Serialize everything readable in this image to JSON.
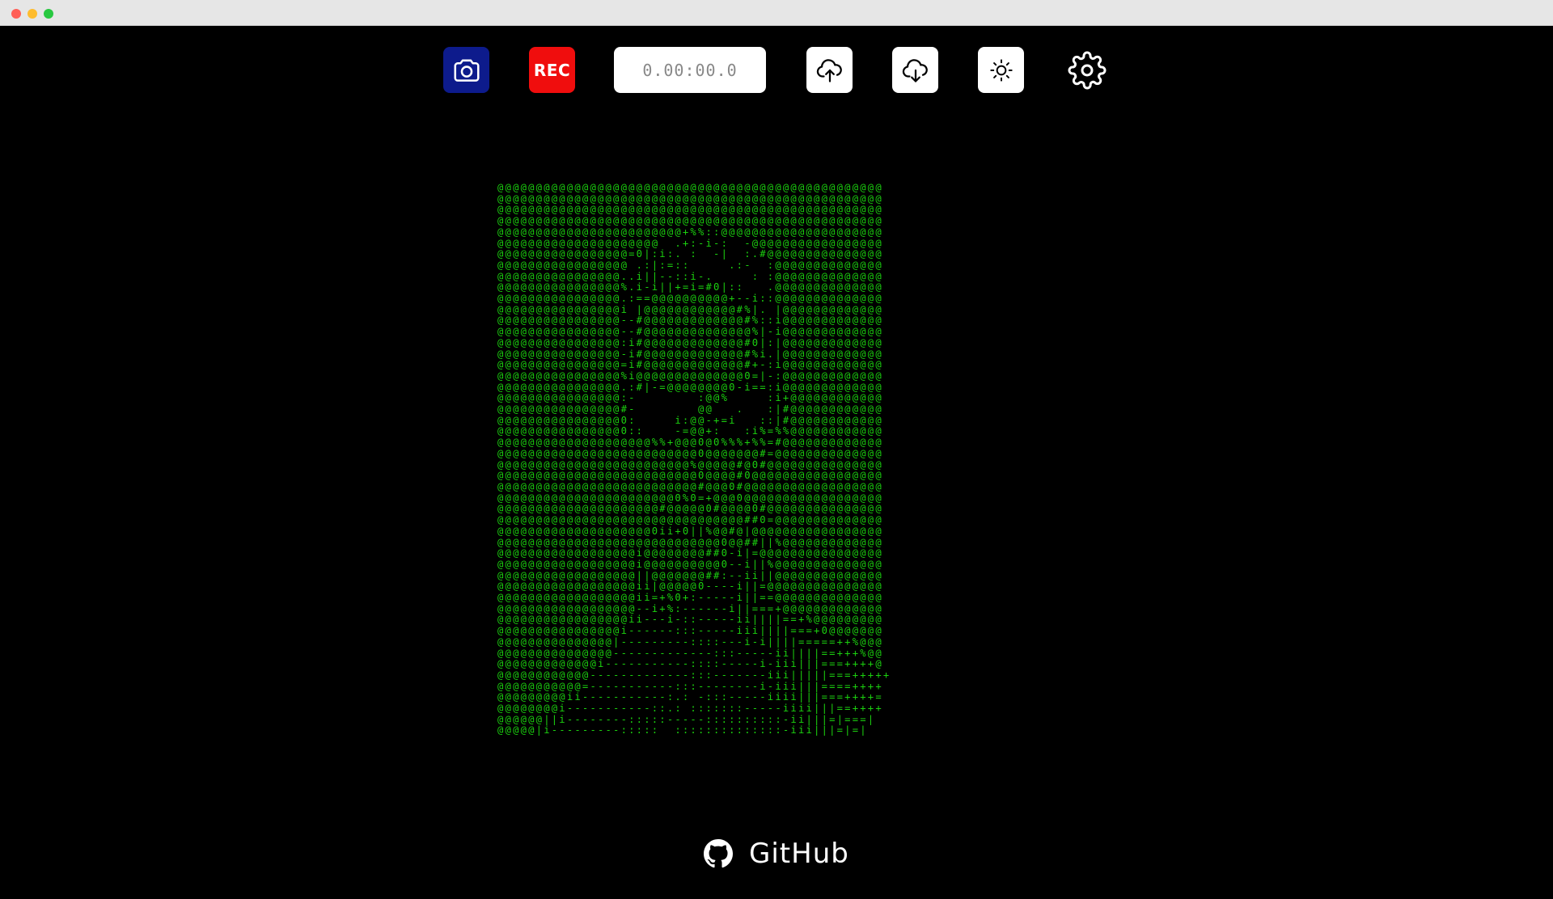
{
  "toolbar": {
    "camera_icon": "camera-icon",
    "rec_label": "REC",
    "timer": "0.00:00.0",
    "upload_icon": "cloud-upload-icon",
    "download_icon": "cloud-download-icon",
    "brightness_icon": "sun-icon",
    "settings_icon": "gear-icon"
  },
  "colors": {
    "camera_button": "#0d1b8c",
    "rec_button": "#f00d0d",
    "ascii_text": "#1bd10f",
    "background": "#000000"
  },
  "ascii_frame": {
    "lines": [
      "@@@@@@@@@@@@@@@@@@@@@@@@@@@@@@@@@@@@@@@@@@@@@@@@@@",
      "@@@@@@@@@@@@@@@@@@@@@@@@@@@@@@@@@@@@@@@@@@@@@@@@@@",
      "@@@@@@@@@@@@@@@@@@@@@@@@@@@@@@@@@@@@@@@@@@@@@@@@@@",
      "@@@@@@@@@@@@@@@@@@@@@@@@@@@@@@@@@@@@@@@@@@@@@@@@@@",
      "@@@@@@@@@@@@@@@@@@@@@@@@+%%::@@@@@@@@@@@@@@@@@@@@@",
      "@@@@@@@@@@@@@@@@@@@@@  .+:-i-:  -@@@@@@@@@@@@@@@@@",
      "@@@@@@@@@@@@@@@@@=0|:i:. :  -|  :.#@@@@@@@@@@@@@@@",
      "@@@@@@@@@@@@@@@@@ .:|:=::     .:-  :@@@@@@@@@@@@@@",
      "@@@@@@@@@@@@@@@@..i||--::i-.     : :@@@@@@@@@@@@@@",
      "@@@@@@@@@@@@@@@@%.i-i||+=i=#0|::   .@@@@@@@@@@@@@@",
      "@@@@@@@@@@@@@@@@.:==@@@@@@@@@@+--i::@@@@@@@@@@@@@@",
      "@@@@@@@@@@@@@@@@i |@@@@@@@@@@@@#%|. |@@@@@@@@@@@@@",
      "@@@@@@@@@@@@@@@@--#@@@@@@@@@@@@@#%::i@@@@@@@@@@@@@",
      "@@@@@@@@@@@@@@@@--#@@@@@@@@@@@@@@%|-i@@@@@@@@@@@@@",
      "@@@@@@@@@@@@@@@@:i#@@@@@@@@@@@@@#0|:|@@@@@@@@@@@@@",
      "@@@@@@@@@@@@@@@@-i#@@@@@@@@@@@@@#%i.|@@@@@@@@@@@@@",
      "@@@@@@@@@@@@@@@@=i#@@@@@@@@@@@@@#+-:i@@@@@@@@@@@@@",
      "@@@@@@@@@@@@@@@@%i@@@@@@@@@@@@@@0=|-:@@@@@@@@@@@@@",
      "@@@@@@@@@@@@@@@@.:#|-=@@@@@@@@0-i==:i@@@@@@@@@@@@@",
      "@@@@@@@@@@@@@@@@:-        :@@%     :i+@@@@@@@@@@@@",
      "@@@@@@@@@@@@@@@@#-        @@   .   :|#@@@@@@@@@@@@",
      "@@@@@@@@@@@@@@@@0:     i:@@-+=i   ::|#@@@@@@@@@@@@",
      "@@@@@@@@@@@@@@@@0::    -=@@+:   :i%=%%@@@@@@@@@@@@",
      "@@@@@@@@@@@@@@@@@@@@%%+@@@0@0%%%+%%=#@@@@@@@@@@@@@",
      "@@@@@@@@@@@@@@@@@@@@@@@@@@0@@@@@@@#=@@@@@@@@@@@@@@",
      "@@@@@@@@@@@@@@@@@@@@@@@@@%@@@@@#@0#@@@@@@@@@@@@@@@",
      "@@@@@@@@@@@@@@@@@@@@@@@@@@0@@@@#0@@@@@@@@@@@@@@@@@",
      "@@@@@@@@@@@@@@@@@@@@@@@@@@#@@@0#@@@@@@@@@@@@@@@@@@",
      "@@@@@@@@@@@@@@@@@@@@@@@0%0=+@@@0@@@@@@@@@@@@@@@@@@",
      "@@@@@@@@@@@@@@@@@@@@@#@@@@@0#@@@@0#@@@@@@@@@@@@@@@",
      "@@@@@@@@@@@@@@@@@@@@@@@@@@@@@@@@##0=@@@@@@@@@@@@@@",
      "@@@@@@@@@@@@@@@@@@@@0ii+0||%@@#@|@@@@@@@@@@@@@@@@@",
      "@@@@@@@@@@@@@@@@@@@@@@@@@@@@@0@@##||%@@@@@@@@@@@@@",
      "@@@@@@@@@@@@@@@@@@i@@@@@@@@##0-i|=@@@@@@@@@@@@@@@@",
      "@@@@@@@@@@@@@@@@@@i@@@@@@@@@@0--i||%@@@@@@@@@@@@@@",
      "@@@@@@@@@@@@@@@@@@||@@@@@@@##:--ii||@@@@@@@@@@@@@@",
      "@@@@@@@@@@@@@@@@@@ii|@@@@@0----i||=@@@@@@@@@@@@@@@",
      "@@@@@@@@@@@@@@@@@@ii=+%0+:-----i||==@@@@@@@@@@@@@@",
      "@@@@@@@@@@@@@@@@@@--i+%:------i||===+@@@@@@@@@@@@@",
      "@@@@@@@@@@@@@@@@@ii---i-::-----ii||||==+%@@@@@@@@@",
      "@@@@@@@@@@@@@@@@i------:::-----iii||||===+0@@@@@@@",
      "@@@@@@@@@@@@@@@|---------::::---i-i||||=====++%@@@",
      "@@@@@@@@@@@@@@@-------------:::-----ii||||==+++%@@",
      "@@@@@@@@@@@@@i-----------::::-----i-iii|||===++++@",
      "@@@@@@@@@@@@-------------:::-------iii|||||===+++++",
      "@@@@@@@@@@@=-----------:::--------i-iii|||====++++",
      "@@@@@@@@@ii-----------:.: -:::-----iiii|||===++++=",
      "@@@@@@@@i-----------::.: :::::::-----iiii|||==++++",
      "@@@@@@||i--------:::::-----::::::::::-ii|||=|===|",
      "@@@@@|i---------:::::  ::::::::::::::-iii|||=|=|"
    ]
  },
  "footer": {
    "github_icon": "github-icon",
    "github_label": "GitHub"
  }
}
